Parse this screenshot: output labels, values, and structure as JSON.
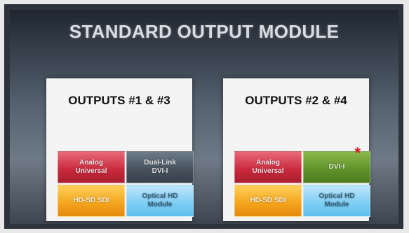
{
  "title": "STANDARD OUTPUT MODULE",
  "cards": [
    {
      "title": "OUTPUTS #1 & #3",
      "tiles": [
        "Analog\nUniversal",
        "Dual-Link\nDVI-I",
        "HD-SD SDI",
        "Optical HD\nModule"
      ]
    },
    {
      "title": "OUTPUTS #2 & #4",
      "tiles": [
        "Analog\nUniversal",
        "DVI-I",
        "HD-SD SDI",
        "Optical HD\nModule"
      ],
      "marker": "*"
    }
  ],
  "colors": {
    "analog": "#c8283b",
    "dual_link": "#45505c",
    "sdi": "#f3a31a",
    "optical": "#7ccdf3",
    "dvi": "#5e8f28",
    "asterisk": "#e0101a"
  }
}
